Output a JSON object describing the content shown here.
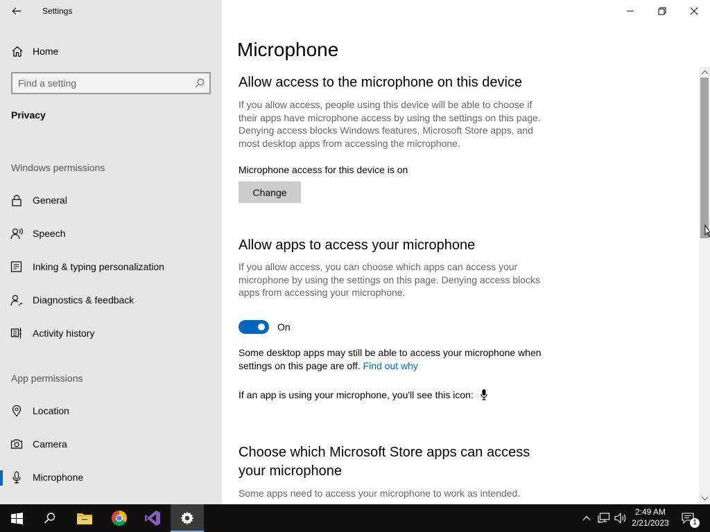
{
  "window": {
    "title": "Settings",
    "minimize_glyph": "—",
    "colors": {
      "accent": "#0067c0",
      "sidebar_bg": "#e6e6e6",
      "link": "#0067b8",
      "taskbar": "#101010"
    }
  },
  "sidebar": {
    "home_label": "Home",
    "search_placeholder": "Find a setting",
    "section_title": "Privacy",
    "groups": [
      {
        "title": "Windows permissions",
        "items": [
          {
            "label": "General",
            "icon": "lock-icon"
          },
          {
            "label": "Speech",
            "icon": "speech-icon"
          },
          {
            "label": "Inking & typing personalization",
            "icon": "inking-icon"
          },
          {
            "label": "Diagnostics & feedback",
            "icon": "diagnostics-icon"
          },
          {
            "label": "Activity history",
            "icon": "activity-history-icon"
          }
        ]
      },
      {
        "title": "App permissions",
        "items": [
          {
            "label": "Location",
            "icon": "location-icon"
          },
          {
            "label": "Camera",
            "icon": "camera-icon"
          },
          {
            "label": "Microphone",
            "icon": "microphone-icon",
            "selected": true
          }
        ]
      }
    ]
  },
  "main": {
    "page_title": "Microphone",
    "device_access": {
      "title": "Allow access to the microphone on this device",
      "description": "If you allow access, people using this device will be able to choose if their apps have microphone access by using the settings on this page. Denying access blocks Windows features, Microsoft Store apps, and most desktop apps from accessing the microphone.",
      "status": "Microphone access for this device is on",
      "change_button": "Change"
    },
    "app_access": {
      "title": "Allow apps to access your microphone",
      "description": "If you allow access, you can choose which apps can access your microphone by using the settings on this page. Denying access blocks apps from accessing your microphone.",
      "toggle_state": "On",
      "toggle_on": true,
      "desktop_note": "Some desktop apps may still be able to access your microphone when settings on this page are off.",
      "find_out_link": "Find out why",
      "icon_note": "If an app is using your microphone, you'll see this icon:"
    },
    "store_apps": {
      "title": "Choose which Microsoft Store apps can access your microphone",
      "description": "Some apps need to access your microphone to work as intended."
    }
  },
  "taskbar": {
    "apps": [
      "start-icon",
      "search-icon",
      "file-explorer-icon",
      "chrome-icon",
      "visual-studio-icon",
      "settings-icon"
    ],
    "active_app": "settings-icon",
    "time": "2:49 AM",
    "date": "2/21/2023",
    "notification_count": "1"
  }
}
